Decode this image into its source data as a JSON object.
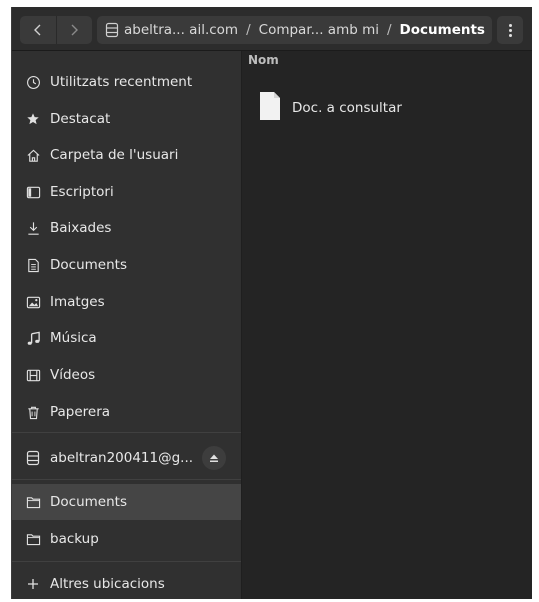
{
  "header": {
    "path": {
      "segment_1": "abeltra... ail.com",
      "separator": "/",
      "segment_2": "Compar... amb mi",
      "segment_3": "Documents"
    }
  },
  "sidebar": {
    "places": [
      {
        "label": "Utilitzats recentment",
        "icon": "clock-icon"
      },
      {
        "label": "Destacat",
        "icon": "star-icon"
      },
      {
        "label": "Carpeta de l'usuari",
        "icon": "home-icon"
      },
      {
        "label": "Escriptori",
        "icon": "desktop-icon"
      },
      {
        "label": "Baixades",
        "icon": "download-icon"
      },
      {
        "label": "Documents",
        "icon": "document-icon"
      },
      {
        "label": "Imatges",
        "icon": "image-icon"
      },
      {
        "label": "Música",
        "icon": "music-icon"
      },
      {
        "label": "Vídeos",
        "icon": "video-icon"
      },
      {
        "label": "Paperera",
        "icon": "trash-icon"
      }
    ],
    "mount": {
      "label": "abeltran200411@g...",
      "icon": "drive-icon"
    },
    "bookmarks": [
      {
        "label": "Documents",
        "icon": "folder-icon",
        "selected": true
      },
      {
        "label": "backup",
        "icon": "folder-icon",
        "selected": false
      }
    ],
    "other_locations": {
      "label": "Altres ubicacions",
      "icon": "plus-icon"
    }
  },
  "content": {
    "column_header": "Nom",
    "files": [
      {
        "name": "Doc. a consultar",
        "icon": "text-file-icon"
      }
    ]
  },
  "colors": {
    "window_bg": "#242424",
    "sidebar_bg": "#303030",
    "selected_bg": "#454545",
    "text": "#e8e8e8"
  }
}
